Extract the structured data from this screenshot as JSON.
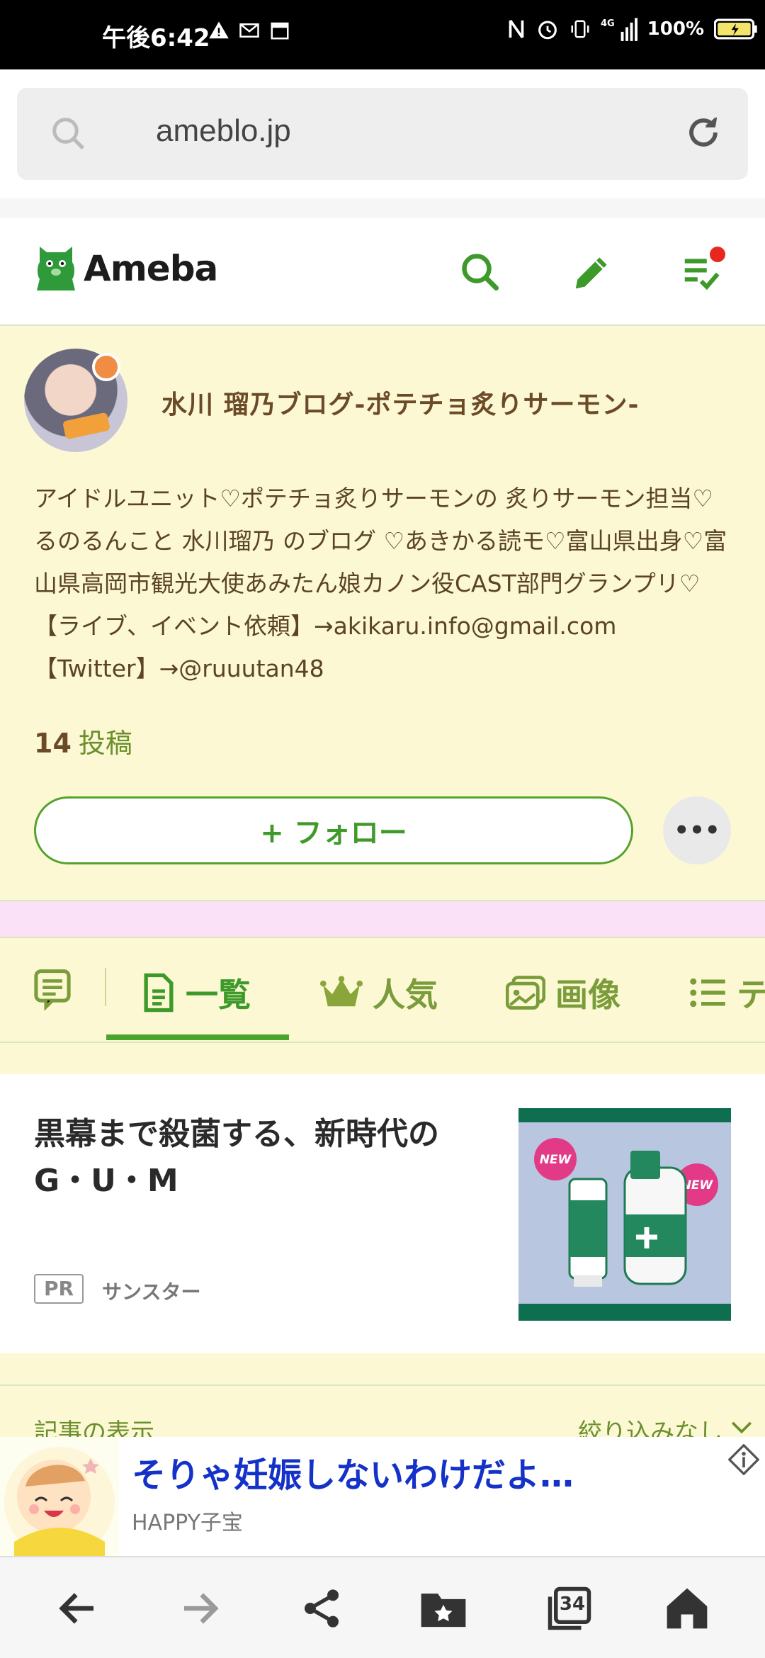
{
  "status_bar": {
    "time": "午後6:42",
    "battery": "100%",
    "network": "4G"
  },
  "browser": {
    "url": "ameblo.jp",
    "tab_count": "34"
  },
  "header": {
    "logo_text": "Ameba"
  },
  "profile": {
    "blog_title": "水川 瑠乃ブログ-ポテチョ炙りサーモン-",
    "description": "アイドルユニット♡ポテチョ炙りサーモンの 炙りサーモン担当♡るのるんこと 水川瑠乃 のブログ ♡あきかる読モ♡富山県出身♡富山県高岡市観光大使あみたん娘カノン役CAST部門グランプリ♡ 【ライブ、イベント依頼】→akikaru.info@gmail.com 【Twitter】→@ruuutan48",
    "post_count": "14",
    "post_label": "投稿",
    "follow_label": "+ フォロー",
    "more_label": "•••"
  },
  "tabs": [
    {
      "label": "一覧"
    },
    {
      "label": "人気"
    },
    {
      "label": "画像"
    },
    {
      "label": "テ"
    }
  ],
  "ad": {
    "title": "黒幕まで殺菌する、新時代のG・U・M",
    "pr_label": "PR",
    "sponsor": "サンスター",
    "image_badge": "NEW"
  },
  "filter": {
    "label": "記事の表示",
    "value": "絞り込みなし"
  },
  "banner": {
    "title": "そりゃ妊娠しないわけだよ…",
    "source": "HAPPY子宝"
  },
  "colors": {
    "brand_green": "#3d9a2a",
    "profile_bg": "#fdf8d4",
    "title_brown": "#6b4a27",
    "banner_blue": "#1432c8",
    "notif_red": "#e8271f"
  }
}
